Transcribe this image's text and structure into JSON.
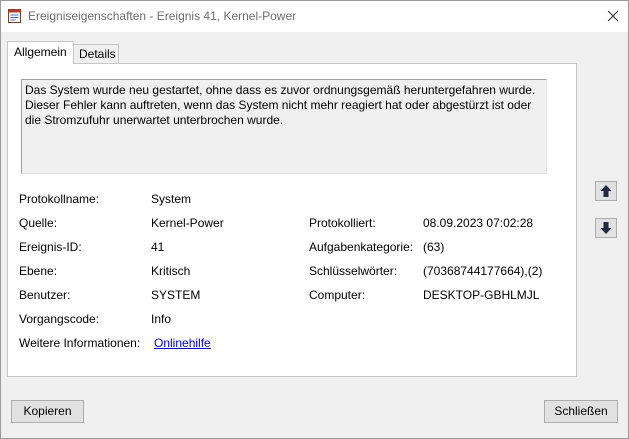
{
  "window": {
    "title": "Ereigniseigenschaften - Ereignis 41, Kernel-Power"
  },
  "tabs": [
    {
      "label": "Allgemein",
      "active": true
    },
    {
      "label": "Details",
      "active": false
    }
  ],
  "description": "Das System wurde neu gestartet, ohne dass es zuvor ordnungsgemäß heruntergefahren wurde. Dieser Fehler kann auftreten, wenn das System nicht mehr reagiert hat oder abgestürzt ist oder die Stromzufuhr unerwartet unterbrochen wurde.",
  "fields": {
    "log_name": {
      "label": "Protokollname:",
      "value": "System"
    },
    "source": {
      "label": "Quelle:",
      "value": "Kernel-Power"
    },
    "logged": {
      "label": "Protokolliert:",
      "value": "08.09.2023 07:02:28"
    },
    "event_id": {
      "label": "Ereignis-ID:",
      "value": "41"
    },
    "task_category": {
      "label": "Aufgabenkategorie:",
      "value": "(63)"
    },
    "level": {
      "label": "Ebene:",
      "value": "Kritisch"
    },
    "keywords": {
      "label": "Schlüsselwörter:",
      "value": "(70368744177664),(2)"
    },
    "user": {
      "label": "Benutzer:",
      "value": "SYSTEM"
    },
    "computer": {
      "label": "Computer:",
      "value": "DESKTOP-GBHLMJL"
    },
    "opcode": {
      "label": "Vorgangscode:",
      "value": "Info"
    },
    "more_info": {
      "label": "Weitere Informationen:",
      "link": "Onlinehilfe"
    }
  },
  "buttons": {
    "copy": "Kopieren",
    "close": "Schließen"
  },
  "icons": {
    "app": "event-viewer-icon",
    "close": "close-icon",
    "up": "arrow-up-icon",
    "down": "arrow-down-icon"
  },
  "colors": {
    "window_bg": "#f0f0f0",
    "link": "#0000cc",
    "title_text": "#6d6d6d"
  }
}
